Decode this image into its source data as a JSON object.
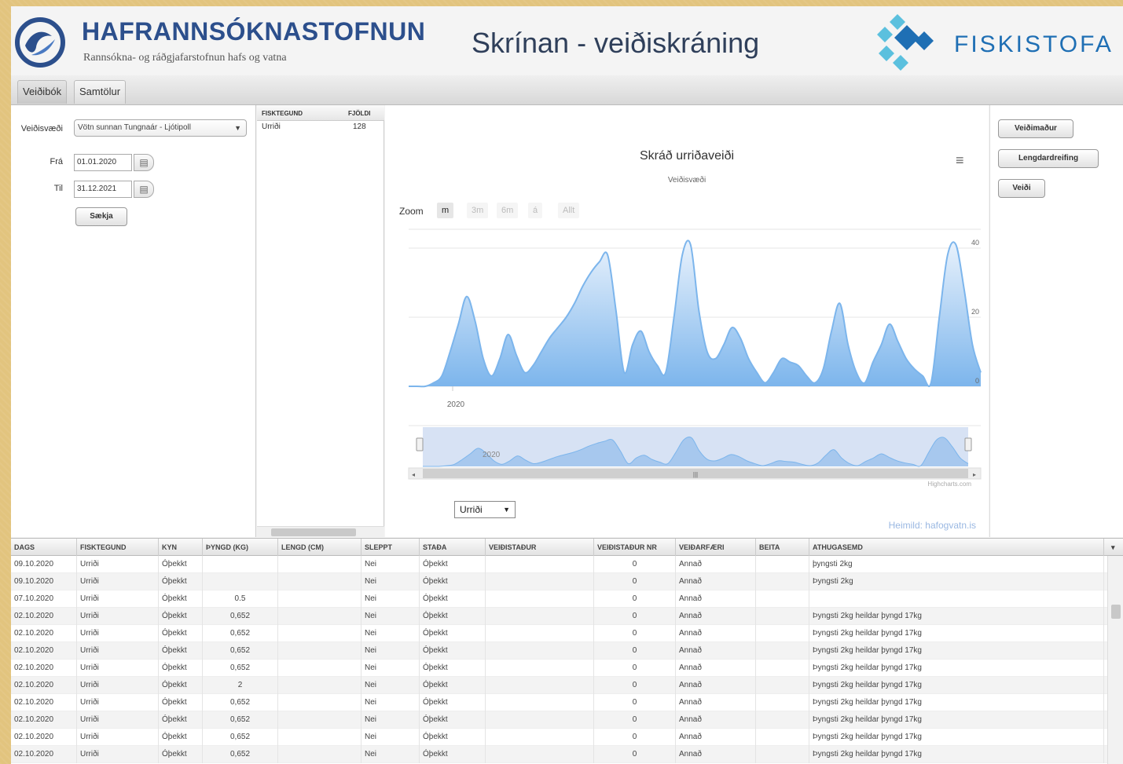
{
  "header": {
    "org_name": "HAFRANNSÓKNASTOFNUN",
    "org_tagline": "Rannsókna- og ráðgjafarstofnun hafs og vatna",
    "app_title": "Skrínan - veiðiskráning",
    "partner_name": "FISKISTOFA"
  },
  "tabs": [
    {
      "label": "Veiðibók",
      "active": true
    },
    {
      "label": "Samtölur",
      "active": false
    }
  ],
  "filters": {
    "veidisvaedi_label": "Veiðisvæði",
    "veidisvaedi_value": "Vötn sunnan Tungnaár - Ljótipoll",
    "fra_label": "Frá",
    "fra_value": "01.01.2020",
    "til_label": "Til",
    "til_value": "31.12.2021",
    "submit_label": "Sækja"
  },
  "species_table": {
    "headers": [
      "FISKTEGUND",
      "FJÖLDI"
    ],
    "rows": [
      {
        "name": "Urriði",
        "count": "128"
      }
    ]
  },
  "chart": {
    "zoom_label": "Zoom",
    "zoom_buttons": [
      "m",
      "3m",
      "6m",
      "á",
      "Allt"
    ],
    "zoom_active": 0,
    "menu_icon": "menu-icon",
    "credits": "Highcharts.com",
    "species_select_value": "Urriði",
    "source_text": "Heimild: hafogvatn.is"
  },
  "chart_data": {
    "type": "area",
    "title": "Skráð urriðaveiði",
    "subtitle": "Veiðisvæði",
    "x_label": "2020",
    "nav_label": "2020",
    "y_ticks": [
      "40",
      "20",
      "0"
    ],
    "ylim": [
      0,
      45
    ],
    "color": "#7cb5ec",
    "values": [
      0,
      0,
      0,
      1,
      3,
      10,
      18,
      26,
      19,
      8,
      3,
      8,
      15,
      9,
      4,
      6,
      10,
      14,
      17,
      20,
      24,
      29,
      33,
      36,
      38,
      22,
      4,
      12,
      16,
      10,
      6,
      4,
      20,
      38,
      41,
      22,
      10,
      8,
      12,
      17,
      14,
      8,
      4,
      1,
      4,
      8,
      7,
      6,
      3,
      1,
      5,
      16,
      24,
      12,
      4,
      1,
      7,
      12,
      18,
      13,
      8,
      5,
      3,
      1,
      20,
      38,
      41,
      28,
      12,
      4
    ],
    "grid": true
  },
  "right_buttons": {
    "veidimadur": "Veiðimaður",
    "lengdardreifing": "Lengdardreifing",
    "veidi": "Veiði"
  },
  "grid": {
    "headers": [
      "DAGS",
      "FISKTEGUND",
      "KYN",
      "ÞYNGD (KG)",
      "LENGD (CM)",
      "SLEPPT",
      "STAÐA",
      "VEIÐISTAÐUR",
      "VEIÐISTAÐUR NR",
      "VEIÐARFÆRI",
      "BEITA",
      "ATHUGASEMD"
    ],
    "rows": [
      [
        "09.10.2020",
        "Urriði",
        "Óþekkt",
        "",
        "",
        "Nei",
        "Óþekkt",
        "",
        "0",
        "Annað",
        "",
        "þyngsti 2kg"
      ],
      [
        "09.10.2020",
        "Urriði",
        "Óþekkt",
        "",
        "",
        "Nei",
        "Óþekkt",
        "",
        "0",
        "Annað",
        "",
        "Þyngsti 2kg"
      ],
      [
        "07.10.2020",
        "Urriði",
        "Óþekkt",
        "0.5",
        "",
        "Nei",
        "Óþekkt",
        "",
        "0",
        "Annað",
        "",
        ""
      ],
      [
        "02.10.2020",
        "Urriði",
        "Óþekkt",
        "0,652",
        "",
        "Nei",
        "Óþekkt",
        "",
        "0",
        "Annað",
        "",
        "Þyngsti 2kg heildar þyngd 17kg"
      ],
      [
        "02.10.2020",
        "Urriði",
        "Óþekkt",
        "0,652",
        "",
        "Nei",
        "Óþekkt",
        "",
        "0",
        "Annað",
        "",
        "Þyngsti 2kg heildar þyngd 17kg"
      ],
      [
        "02.10.2020",
        "Urriði",
        "Óþekkt",
        "0,652",
        "",
        "Nei",
        "Óþekkt",
        "",
        "0",
        "Annað",
        "",
        "Þyngsti 2kg heildar þyngd 17kg"
      ],
      [
        "02.10.2020",
        "Urriði",
        "Óþekkt",
        "0,652",
        "",
        "Nei",
        "Óþekkt",
        "",
        "0",
        "Annað",
        "",
        "Þyngsti 2kg heildar þyngd 17kg"
      ],
      [
        "02.10.2020",
        "Urriði",
        "Óþekkt",
        "2",
        "",
        "Nei",
        "Óþekkt",
        "",
        "0",
        "Annað",
        "",
        "Þyngsti 2kg heildar þyngd 17kg"
      ],
      [
        "02.10.2020",
        "Urriði",
        "Óþekkt",
        "0,652",
        "",
        "Nei",
        "Óþekkt",
        "",
        "0",
        "Annað",
        "",
        "Þyngsti 2kg heildar þyngd 17kg"
      ],
      [
        "02.10.2020",
        "Urriði",
        "Óþekkt",
        "0,652",
        "",
        "Nei",
        "Óþekkt",
        "",
        "0",
        "Annað",
        "",
        "Þyngsti 2kg heildar þyngd 17kg"
      ],
      [
        "02.10.2020",
        "Urriði",
        "Óþekkt",
        "0,652",
        "",
        "Nei",
        "Óþekkt",
        "",
        "0",
        "Annað",
        "",
        "Þyngsti 2kg heildar þyngd 17kg"
      ],
      [
        "02.10.2020",
        "Urriði",
        "Óþekkt",
        "0,652",
        "",
        "Nei",
        "Óþekkt",
        "",
        "0",
        "Annað",
        "",
        "Þyngsti 2kg heildar þyngd 17kg"
      ]
    ]
  },
  "colors": {
    "background": "#e2c47e",
    "brand_blue": "#2c4f8c",
    "fiskistofa_blue": "#1f6fb4",
    "series": "#7cb5ec"
  }
}
